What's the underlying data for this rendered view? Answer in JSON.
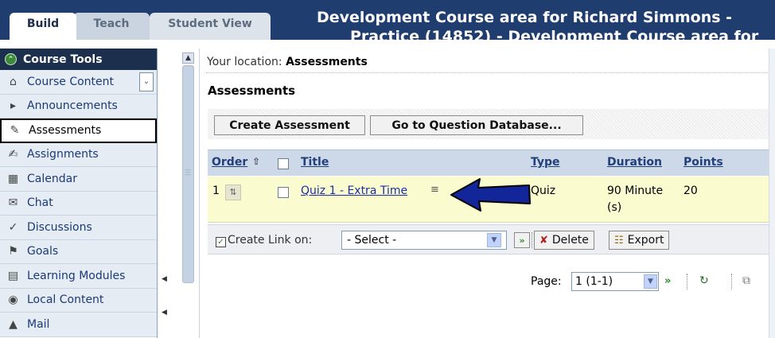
{
  "tabs": [
    {
      "label": "Build",
      "active": true
    },
    {
      "label": "Teach",
      "active": false
    },
    {
      "label": "Student View",
      "active": false
    }
  ],
  "course_title_line1": "Development Course area for Richard Simmons -",
  "course_title_line2": "Practice (14852) - Development Course area for",
  "sidebar": {
    "header": "Course Tools",
    "items": [
      {
        "label": "Course Content",
        "icon": "home-icon"
      },
      {
        "label": "Announcements",
        "icon": "megaphone-icon"
      },
      {
        "label": "Assessments",
        "icon": "assessment-icon",
        "selected": true
      },
      {
        "label": "Assignments",
        "icon": "assignment-icon"
      },
      {
        "label": "Calendar",
        "icon": "calendar-icon"
      },
      {
        "label": "Chat",
        "icon": "chat-icon"
      },
      {
        "label": "Discussions",
        "icon": "discussion-icon"
      },
      {
        "label": "Goals",
        "icon": "goals-icon"
      },
      {
        "label": "Learning Modules",
        "icon": "module-icon"
      },
      {
        "label": "Local Content",
        "icon": "local-content-icon"
      },
      {
        "label": "Mail",
        "icon": "mail-icon"
      }
    ]
  },
  "location": {
    "prefix": "Your location:",
    "value": "Assessments"
  },
  "page_title": "Assessments",
  "toolbar": {
    "create_label": "Create Assessment",
    "question_db_label": "Go to Question Database..."
  },
  "table": {
    "columns": {
      "order": "Order",
      "title": "Title",
      "type": "Type",
      "duration": "Duration",
      "points": "Points"
    },
    "rows": [
      {
        "order": "1",
        "title": "Quiz 1 - Extra Time",
        "type": "Quiz",
        "duration_line1": "90 Minute",
        "duration_line2": "(s)",
        "points": "20"
      }
    ]
  },
  "link_bar": {
    "label": "Create Link on:",
    "select_value": "- Select -",
    "delete_label": "Delete",
    "export_label": "Export"
  },
  "pagination": {
    "label": "Page:",
    "value": "1 (1-1)"
  },
  "colors": {
    "header_bg": "#1f3d6e",
    "sidebar_header": "#1c2f4c",
    "row_highlight": "#fbfbd0",
    "table_header": "#cdd9e8",
    "arrow": "#12269a"
  }
}
